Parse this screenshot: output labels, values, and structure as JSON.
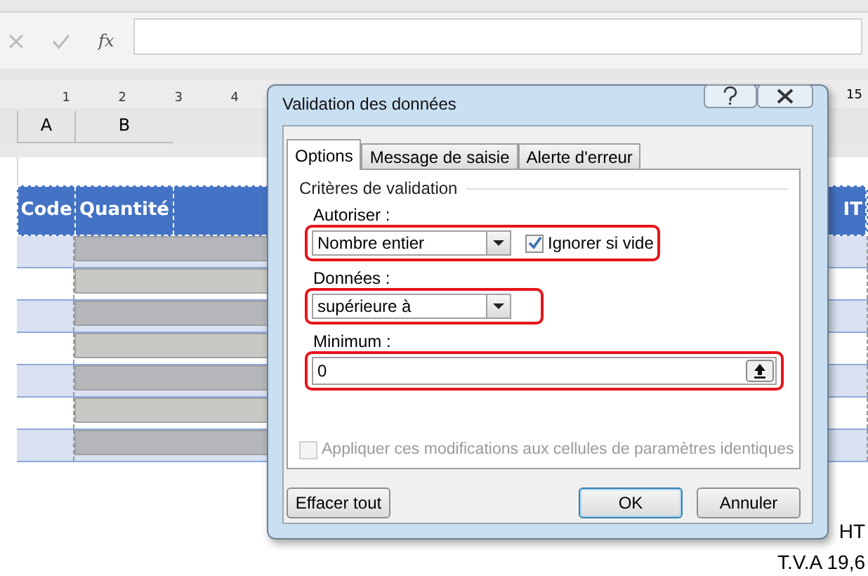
{
  "formula_bar": {
    "function_label": "fx"
  },
  "ruler": {
    "labels": [
      "1",
      "2",
      "3",
      "4"
    ],
    "edge_label": "15"
  },
  "column_headers": [
    "A",
    "B"
  ],
  "table": {
    "headers": [
      "Code",
      "Quantité"
    ],
    "edge_header": "IT"
  },
  "totals": [
    "HT",
    "T.V.A 19,6"
  ],
  "dialog": {
    "title": "Validation des données",
    "tabs": [
      {
        "label": "Options",
        "selected": true
      },
      {
        "label": "Message de saisie",
        "selected": false
      },
      {
        "label": "Alerte d'erreur",
        "selected": false
      }
    ],
    "group_title": "Critères de validation",
    "allow": {
      "label": "Autoriser :",
      "value": "Nombre entier",
      "highlighted": true
    },
    "ignore_blank": {
      "label": "Ignorer si vide",
      "checked": true
    },
    "data": {
      "label": "Données :",
      "value": "supérieure à",
      "highlighted": true
    },
    "minimum": {
      "label": "Minimum :",
      "value": "0",
      "highlighted": true
    },
    "apply_all": {
      "label": "Appliquer ces modifications aux cellules de paramètres identiques",
      "checked": false,
      "disabled": true
    },
    "buttons": [
      {
        "label": "Effacer tout",
        "kind": "left"
      },
      {
        "label": "OK",
        "kind": "default"
      },
      {
        "label": "Annuler",
        "kind": "normal"
      }
    ]
  }
}
